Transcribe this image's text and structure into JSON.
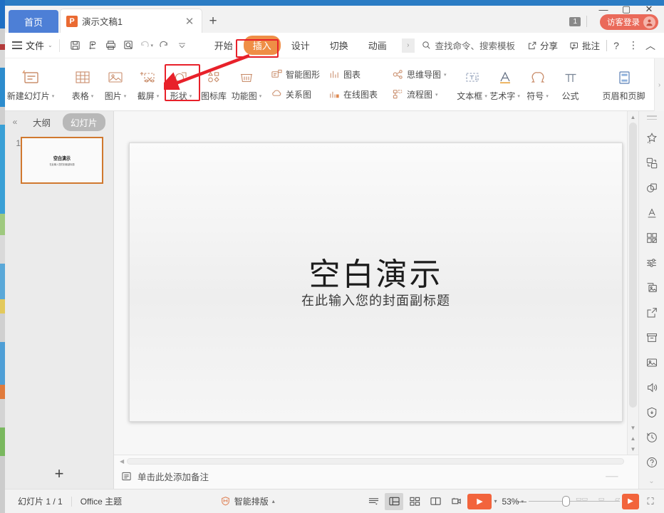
{
  "app": {
    "window_title": "演示文稿1",
    "home_tab_label": "首页",
    "new_tab_label": "+",
    "tab_close_label": "✕",
    "minimize_label": "—",
    "maximize_label": "▢",
    "close_label": "✕",
    "count_badge": "1",
    "login_label": "访客登录",
    "accent_orange": "#ef8e46",
    "accent_red": "#e8212a",
    "brand_red": "#f2643c",
    "tab_blue": "#4d7fd6"
  },
  "menubar": {
    "file_label": "文件",
    "quick_access": [
      {
        "name": "save-icon",
        "title": "保存"
      },
      {
        "name": "cloud-sync-icon",
        "title": "同步"
      },
      {
        "name": "print-icon",
        "title": "打印"
      },
      {
        "name": "print-preview-icon",
        "title": "打印预览"
      },
      {
        "name": "undo-icon",
        "title": "撤销"
      },
      {
        "name": "redo-icon",
        "title": "恢复"
      },
      {
        "name": "customize-qat-icon",
        "title": "自定义快速访问工具栏"
      }
    ],
    "tabs": [
      {
        "label": "开始",
        "active": false
      },
      {
        "label": "插入",
        "active": true
      },
      {
        "label": "设计",
        "active": false
      },
      {
        "label": "切换",
        "active": false
      },
      {
        "label": "动画",
        "active": false
      }
    ],
    "more_tabs_label": "›",
    "search_placeholder": "查找命令、搜索模板",
    "share_label": "分享",
    "comment_label": "批注",
    "help_label": "?",
    "more_label": "⋮",
    "collapse_label": "︿"
  },
  "ribbon": {
    "groups": [
      {
        "items": [
          {
            "label": "新建幻灯片",
            "icon": "new-slide-icon",
            "caret": true
          }
        ]
      },
      {
        "items": [
          {
            "label": "表格",
            "icon": "table-icon",
            "caret": true
          },
          {
            "label": "图片",
            "icon": "picture-icon",
            "caret": true
          },
          {
            "label": "截屏",
            "icon": "screenshot-icon",
            "caret": true
          },
          {
            "label": "形状",
            "icon": "shapes-icon",
            "caret": true
          },
          {
            "label": "图标库",
            "icon": "icon-library-icon",
            "caret": false
          },
          {
            "label": "功能图",
            "icon": "function-chart-icon",
            "caret": true
          }
        ]
      }
    ],
    "stacked": [
      {
        "top": "智能图形",
        "bottom": "关系图",
        "top_icon": "smartart-icon",
        "bottom_icon": "relationship-icon"
      },
      {
        "top": "图表",
        "bottom": "在线图表",
        "top_icon": "chart-icon",
        "bottom_icon": "online-chart-icon"
      },
      {
        "top": "思维导图",
        "bottom": "流程图",
        "top_icon": "mindmap-icon",
        "bottom_icon": "flowchart-icon",
        "top_caret": true,
        "bottom_caret": true
      }
    ],
    "text_group": [
      {
        "label": "文本框",
        "icon": "textbox-icon",
        "caret": true
      },
      {
        "label": "艺术字",
        "icon": "wordart-icon",
        "caret": true
      },
      {
        "label": "符号",
        "icon": "symbol-icon",
        "caret": true
      },
      {
        "label": "公式",
        "icon": "equation-icon",
        "caret": false
      }
    ],
    "doc_group": [
      {
        "label": "页眉和页脚",
        "icon": "header-footer-icon",
        "caret": false
      }
    ],
    "overflow_label": "›"
  },
  "slide_panel": {
    "outline_tab": "大纲",
    "slides_tab": "幻灯片",
    "collapse_label": "«",
    "add_label": "+",
    "thumbnails": [
      {
        "number": "1",
        "title": "空白演示",
        "subtitle": "在此输入您的封面副标题",
        "selected": true
      }
    ]
  },
  "slide": {
    "title": "空白演示",
    "subtitle": "在此输入您的封面副标题"
  },
  "notes": {
    "placeholder": "单击此处添加备注",
    "icon": "notes-icon",
    "resize_hint": "⸺"
  },
  "right_rail": {
    "icons": [
      {
        "name": "sparkle-star-icon",
        "title": "智能美化"
      },
      {
        "name": "swap-shapes-icon",
        "title": "替换"
      },
      {
        "name": "shapes-overlap-icon",
        "title": "形状"
      },
      {
        "name": "wordart-a-icon",
        "title": "艺术字"
      },
      {
        "name": "grid-apps-icon",
        "title": "素材库"
      },
      {
        "name": "sliders-icon",
        "title": "设置"
      },
      {
        "name": "image-frame-icon",
        "title": "图片"
      },
      {
        "name": "share-out-icon",
        "title": "分享"
      },
      {
        "name": "archive-box-icon",
        "title": "收纳"
      },
      {
        "name": "photo-icon",
        "title": "相册"
      },
      {
        "name": "speaker-icon",
        "title": "音频"
      },
      {
        "name": "shield-icon",
        "title": "安全"
      },
      {
        "name": "history-clock-icon",
        "title": "历史"
      },
      {
        "name": "help-circle-icon",
        "title": "帮助"
      }
    ],
    "chevron_label": "⌄"
  },
  "statusbar": {
    "slide_count": "幻灯片 1 / 1",
    "theme": "Office 主题",
    "smart_layout": "智能排版",
    "smart_layout_caret": "▴",
    "view_buttons": [
      {
        "name": "outline-view-icon",
        "selected": false,
        "caret": true
      },
      {
        "name": "normal-view-icon",
        "selected": true,
        "caret": false
      },
      {
        "name": "slide-sorter-icon",
        "selected": false,
        "caret": false
      },
      {
        "name": "reading-view-icon",
        "selected": false,
        "caret": false
      },
      {
        "name": "presenter-view-icon",
        "selected": false,
        "caret": false
      }
    ],
    "play_label": "▶",
    "play_caret": "▾",
    "zoom_level": "53%",
    "zoom_caret": "▾",
    "zoom_minus": "—",
    "zoom_marks": [
      "▭▭",
      "▭",
      "▱"
    ],
    "fit_label": "▶",
    "fullscreen_label": "⛶"
  },
  "annotations": [
    {
      "name": "insert-tab-highlight",
      "target": "插入"
    },
    {
      "name": "shapes-button-highlight",
      "target": "形状"
    },
    {
      "name": "pointer-arrow",
      "from": "插入",
      "to": "形状"
    }
  ]
}
